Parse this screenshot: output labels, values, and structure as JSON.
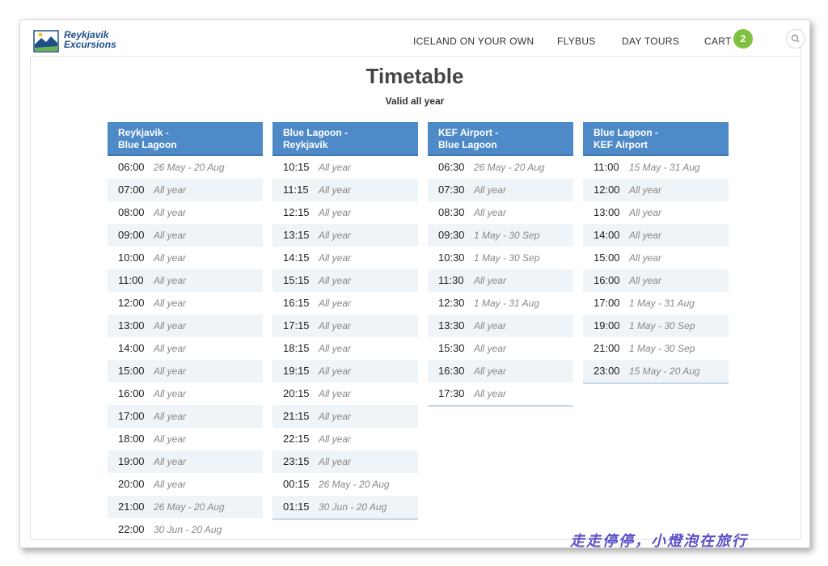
{
  "header": {
    "logo_line1": "Reykjavik",
    "logo_line2": "Excursions",
    "nav": [
      "ICELAND ON YOUR OWN",
      "FLYBUS",
      "DAY TOURS",
      "CART"
    ],
    "cart_count": "2",
    "search_icon": "search-icon"
  },
  "page": {
    "title": "Timetable",
    "subtitle": "Valid all year"
  },
  "columns": [
    {
      "header": [
        "Reykjavik -",
        "Blue Lagoon"
      ],
      "rows": [
        [
          "06:00",
          "26 May - 20 Aug"
        ],
        [
          "07:00",
          "All year"
        ],
        [
          "08:00",
          "All year"
        ],
        [
          "09:00",
          "All year"
        ],
        [
          "10:00",
          "All year"
        ],
        [
          "11:00",
          "All year"
        ],
        [
          "12:00",
          "All year"
        ],
        [
          "13:00",
          "All year"
        ],
        [
          "14:00",
          "All year"
        ],
        [
          "15:00",
          "All year"
        ],
        [
          "16:00",
          "All year"
        ],
        [
          "17:00",
          "All year"
        ],
        [
          "18:00",
          "All year"
        ],
        [
          "19:00",
          "All year"
        ],
        [
          "20:00",
          "All year"
        ],
        [
          "21:00",
          "26 May - 20 Aug"
        ],
        [
          "22:00",
          "30 Jun - 20 Aug"
        ]
      ]
    },
    {
      "header": [
        "Blue Lagoon -",
        "Reykjavik"
      ],
      "rows": [
        [
          "10:15",
          "All year"
        ],
        [
          "11:15",
          "All year"
        ],
        [
          "12:15",
          "All year"
        ],
        [
          "13:15",
          "All year"
        ],
        [
          "14:15",
          "All year"
        ],
        [
          "15:15",
          "All year"
        ],
        [
          "16:15",
          "All year"
        ],
        [
          "17:15",
          "All year"
        ],
        [
          "18:15",
          "All year"
        ],
        [
          "19:15",
          "All year"
        ],
        [
          "20:15",
          "All year"
        ],
        [
          "21:15",
          "All year"
        ],
        [
          "22:15",
          "All year"
        ],
        [
          "23:15",
          "All year"
        ],
        [
          "00:15",
          "26 May - 20 Aug"
        ],
        [
          "01:15",
          "30 Jun - 20 Aug"
        ]
      ]
    },
    {
      "header": [
        "KEF Airport -",
        "Blue Lagoon"
      ],
      "rows": [
        [
          "06:30",
          "26 May - 20 Aug"
        ],
        [
          "07:30",
          "All year"
        ],
        [
          "08:30",
          "All year"
        ],
        [
          "09:30",
          "1 May - 30 Sep"
        ],
        [
          "10:30",
          "1 May - 30 Sep"
        ],
        [
          "11:30",
          "All year"
        ],
        [
          "12:30",
          "1 May - 31 Aug"
        ],
        [
          "13:30",
          "All year"
        ],
        [
          "15:30",
          "All year"
        ],
        [
          "16:30",
          "All year"
        ],
        [
          "17:30",
          "All year"
        ]
      ]
    },
    {
      "header": [
        "Blue Lagoon -",
        "KEF Airport"
      ],
      "rows": [
        [
          "11:00",
          "15 May - 31 Aug"
        ],
        [
          "12:00",
          "All year"
        ],
        [
          "13:00",
          "All year"
        ],
        [
          "14:00",
          "All year"
        ],
        [
          "15:00",
          "All year"
        ],
        [
          "16:00",
          "All year"
        ],
        [
          "17:00",
          "1 May - 31 Aug"
        ],
        [
          "19:00",
          "1 May - 30 Sep"
        ],
        [
          "21:00",
          "1 May - 30 Sep"
        ],
        [
          "23:00",
          "15 May - 20 Aug"
        ]
      ]
    }
  ],
  "watermark": "走走停停，小燈泡在旅行",
  "colors": {
    "header_blue": "#4f8ac8",
    "row_alt": "#eef4f8",
    "cart_green": "#7fc241",
    "logo_blue": "#1f4e8c"
  }
}
